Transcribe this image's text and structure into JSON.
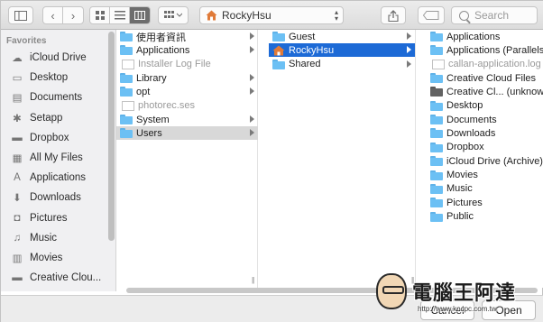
{
  "toolbar": {
    "path_label": "RockyHsu",
    "search_placeholder": "Search"
  },
  "sidebar": {
    "heading": "Favorites",
    "items": [
      {
        "label": "iCloud Drive",
        "icon": "cloud-icon"
      },
      {
        "label": "Desktop",
        "icon": "desktop-icon"
      },
      {
        "label": "Documents",
        "icon": "documents-icon"
      },
      {
        "label": "Setapp",
        "icon": "setapp-icon"
      },
      {
        "label": "Dropbox",
        "icon": "folder-icon"
      },
      {
        "label": "All My Files",
        "icon": "all-files-icon"
      },
      {
        "label": "Applications",
        "icon": "applications-icon"
      },
      {
        "label": "Downloads",
        "icon": "downloads-icon"
      },
      {
        "label": "Pictures",
        "icon": "camera-icon"
      },
      {
        "label": "Music",
        "icon": "music-icon"
      },
      {
        "label": "Movies",
        "icon": "film-icon"
      },
      {
        "label": "Creative Clou...",
        "icon": "folder-icon"
      }
    ]
  },
  "column1": {
    "rows": [
      {
        "label": "使用者資訊",
        "kind": "folder",
        "has_children": true
      },
      {
        "label": "Applications",
        "kind": "folder",
        "has_children": true
      },
      {
        "label": "Installer Log File",
        "kind": "file",
        "has_children": false
      },
      {
        "label": "Library",
        "kind": "folder",
        "has_children": true
      },
      {
        "label": "opt",
        "kind": "folder",
        "has_children": true
      },
      {
        "label": "photorec.ses",
        "kind": "file",
        "has_children": false
      },
      {
        "label": "System",
        "kind": "folder",
        "has_children": true
      },
      {
        "label": "Users",
        "kind": "folder",
        "has_children": true,
        "selected": "inactive"
      }
    ]
  },
  "column2": {
    "rows": [
      {
        "label": "Guest",
        "kind": "folder",
        "has_children": true
      },
      {
        "label": "RockyHsu",
        "kind": "home",
        "has_children": true,
        "selected": "active"
      },
      {
        "label": "Shared",
        "kind": "folder",
        "has_children": true
      }
    ]
  },
  "column3": {
    "rows": [
      {
        "label": "Applications",
        "kind": "folder"
      },
      {
        "label": "Applications (Parallels)",
        "kind": "folder"
      },
      {
        "label": "callan-application.log",
        "kind": "file"
      },
      {
        "label": "Creative Cloud Files",
        "kind": "folder"
      },
      {
        "label": "Creative Cl... (unknown)",
        "kind": "folder-dark"
      },
      {
        "label": "Desktop",
        "kind": "folder"
      },
      {
        "label": "Documents",
        "kind": "folder"
      },
      {
        "label": "Downloads",
        "kind": "folder"
      },
      {
        "label": "Dropbox",
        "kind": "folder"
      },
      {
        "label": "iCloud Drive (Archive)",
        "kind": "folder"
      },
      {
        "label": "Movies",
        "kind": "folder"
      },
      {
        "label": "Music",
        "kind": "folder"
      },
      {
        "label": "Pictures",
        "kind": "folder"
      },
      {
        "label": "Public",
        "kind": "folder"
      }
    ]
  },
  "buttons": {
    "cancel": "Cancel",
    "open": "Open"
  },
  "watermark": {
    "title": "電腦王阿達",
    "url": "http://www.kocpc.com.tw"
  },
  "colors": {
    "selection_active": "#1d6ad6",
    "selection_inactive": "#d8d8d8",
    "folder": "#6cc0f4"
  }
}
